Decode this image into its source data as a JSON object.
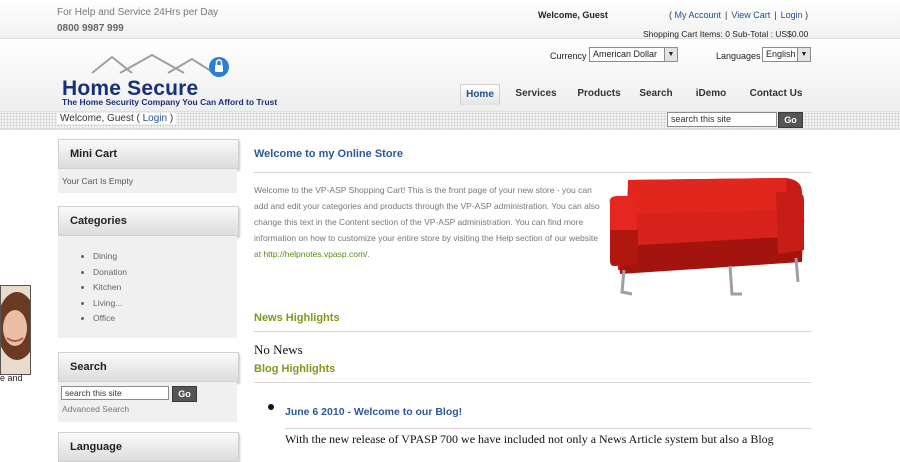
{
  "top": {
    "help_text": "For Help and Service 24Hrs per Day",
    "phone": "0800 9987 999",
    "welcome": "Welcome, Guest",
    "my_account": "My Account",
    "view_cart": "View Cart",
    "login": "Login",
    "cart_summary": "Shopping Cart Items: 0   Sub-Total : US$0.00"
  },
  "logo": {
    "title": "Home Secure",
    "tagline": "The Home Security Company You Can Afford to Trust"
  },
  "currency": {
    "label": "Currency",
    "value": "American Dollar"
  },
  "languages": {
    "label": "Languages",
    "value": "English"
  },
  "nav": [
    "Home",
    "Services",
    "Products",
    "Search",
    "iDemo",
    "Contact Us"
  ],
  "subbar": {
    "welcome_prefix": "Welcome, Guest (",
    "login": "Login",
    "welcome_suffix": ")",
    "search_placeholder": "search this site",
    "go": "Go"
  },
  "sidebar": {
    "mini_cart_title": "Mini Cart",
    "mini_cart_text": "Your Cart Is Empty",
    "categories_title": "Categories",
    "categories": [
      "Dining",
      "Donation",
      "Kitchen",
      "Living...",
      "Office"
    ],
    "search_title": "Search",
    "search_placeholder": "search this site",
    "go": "Go",
    "advanced_search": "Advanced Search",
    "language_title": "Language"
  },
  "photo_tail_text": "e and",
  "main": {
    "title": "Welcome to my Online Store",
    "intro": "Welcome to the VP-ASP Shopping Cart! This is the front page of your new store - you can add and edit your categories and products through the VP-ASP administration. You can also change this text in the Content section of the VP-ASP administration. You can find more information on how to customize your entire store by visiting the Help section of our website at ",
    "intro_link": "http://helpnotes.vpasp.com/",
    "intro_end": ".",
    "news_title": "News Highlights",
    "no_news": "No News",
    "blog_title": "Blog Highlights",
    "blog_post_title": "June 6 2010 - Welcome to our Blog!",
    "blog_post_text": "With the new release of VPASP 700 we have included not only a News Article system but also a Blog"
  },
  "colors": {
    "brand_navy": "#17307a",
    "link_blue": "#2a5a9c",
    "accent_green": "#7a9a18",
    "sofa_red": "#d8231c"
  }
}
